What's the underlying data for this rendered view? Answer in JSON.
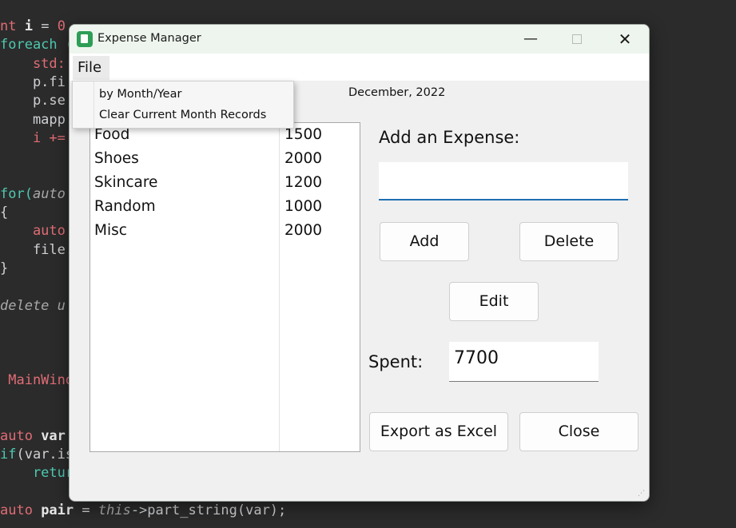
{
  "background_code": [
    {
      "parts": [
        {
          "t": "nt ",
          "c": "c-red"
        },
        {
          "t": "i",
          "c": "c-bold"
        },
        {
          "t": " = ",
          "c": "c-def"
        },
        {
          "t": "0",
          "c": "c-red"
        }
      ]
    },
    {
      "parts": [
        {
          "t": "foreach (",
          "c": "c-teal"
        }
      ]
    },
    {
      "parts": [
        {
          "t": "    std::",
          "c": "c-red"
        }
      ]
    },
    {
      "parts": [
        {
          "t": "    p.fi",
          "c": "c-def"
        }
      ]
    },
    {
      "parts": [
        {
          "t": "    p.se",
          "c": "c-def"
        }
      ]
    },
    {
      "parts": [
        {
          "t": "    mapp",
          "c": "c-def"
        }
      ]
    },
    {
      "parts": [
        {
          "t": "    i +=",
          "c": "c-red"
        }
      ]
    },
    {
      "parts": [
        {
          "t": "",
          "c": "c-def"
        }
      ]
    },
    {
      "parts": [
        {
          "t": "",
          "c": "c-def"
        }
      ]
    },
    {
      "parts": [
        {
          "t": "for(",
          "c": "c-teal"
        },
        {
          "t": "auto",
          "c": "c-it"
        }
      ]
    },
    {
      "parts": [
        {
          "t": "{",
          "c": "c-def"
        }
      ]
    },
    {
      "parts": [
        {
          "t": "    auto",
          "c": "c-red"
        }
      ]
    },
    {
      "parts": [
        {
          "t": "    file.",
          "c": "c-def"
        }
      ]
    },
    {
      "parts": [
        {
          "t": "}",
          "c": "c-def"
        }
      ]
    },
    {
      "parts": [
        {
          "t": "",
          "c": "c-def"
        }
      ]
    },
    {
      "parts": [
        {
          "t": "delete u",
          "c": "c-it"
        }
      ]
    },
    {
      "parts": [
        {
          "t": "",
          "c": "c-def"
        }
      ]
    },
    {
      "parts": [
        {
          "t": "",
          "c": "c-def"
        }
      ]
    },
    {
      "parts": [
        {
          "t": "",
          "c": "c-def"
        }
      ]
    },
    {
      "parts": [
        {
          "t": " MainWind",
          "c": "c-red"
        }
      ]
    },
    {
      "parts": [
        {
          "t": "",
          "c": "c-def"
        }
      ]
    },
    {
      "parts": [
        {
          "t": "",
          "c": "c-def"
        }
      ]
    },
    {
      "parts": [
        {
          "t": "auto ",
          "c": "c-red"
        },
        {
          "t": "var",
          "c": "c-bold"
        }
      ]
    },
    {
      "parts": [
        {
          "t": "if",
          "c": "c-teal"
        },
        {
          "t": "(var.is",
          "c": "c-def"
        }
      ]
    },
    {
      "parts": [
        {
          "t": "    retur",
          "c": "c-teal"
        }
      ]
    },
    {
      "parts": [
        {
          "t": "",
          "c": "c-def"
        }
      ]
    },
    {
      "parts": [
        {
          "t": "auto ",
          "c": "c-red"
        },
        {
          "t": "pair",
          "c": "c-bold"
        },
        {
          "t": " = ",
          "c": "c-def"
        },
        {
          "t": "this",
          "c": "c-it"
        },
        {
          "t": "->part_string(var);",
          "c": "c-def"
        }
      ]
    }
  ],
  "window": {
    "title": "Expense Manager",
    "controls": {
      "minimize": "—",
      "close": "✕"
    }
  },
  "menubar": {
    "file_label": "File"
  },
  "file_menu": {
    "items": [
      "by Month/Year",
      "Clear Current Month Records"
    ]
  },
  "date_label": "December, 2022",
  "expenses": [
    {
      "category": "Food",
      "amount": "1500"
    },
    {
      "category": "Shoes",
      "amount": "2000"
    },
    {
      "category": "Skincare",
      "amount": "1200"
    },
    {
      "category": "Random",
      "amount": "1000"
    },
    {
      "category": "Misc",
      "amount": "2000"
    }
  ],
  "add_expense": {
    "label": "Add an Expense:",
    "input_value": ""
  },
  "buttons": {
    "add": "Add",
    "delete": "Delete",
    "edit": "Edit",
    "export": "Export as Excel",
    "close": "Close"
  },
  "spent": {
    "label": "Spent:",
    "value": "7700"
  },
  "colors": {
    "input_focus_border": "#1f6fb2",
    "titlebar_bg": "#eef5ee",
    "app_icon": "#2e9e56"
  }
}
